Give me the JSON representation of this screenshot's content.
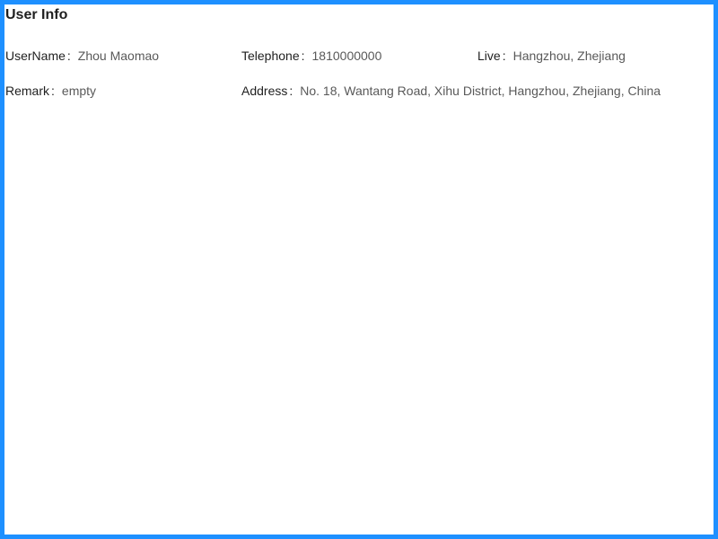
{
  "title": "User Info",
  "rows": [
    [
      {
        "label": "UserName",
        "value": "Zhou Maomao"
      },
      {
        "label": "Telephone",
        "value": "1810000000"
      },
      {
        "label": "Live",
        "value": "Hangzhou, Zhejiang"
      }
    ],
    [
      {
        "label": "Remark",
        "value": "empty"
      },
      {
        "label": "Address",
        "value": "No. 18, Wantang Road, Xihu District, Hangzhou, Zhejiang, China"
      }
    ]
  ],
  "separator": ":",
  "colors": {
    "frame_border": "#1e90ff",
    "label_text": "#1f1f1f",
    "value_text": "#595959"
  }
}
